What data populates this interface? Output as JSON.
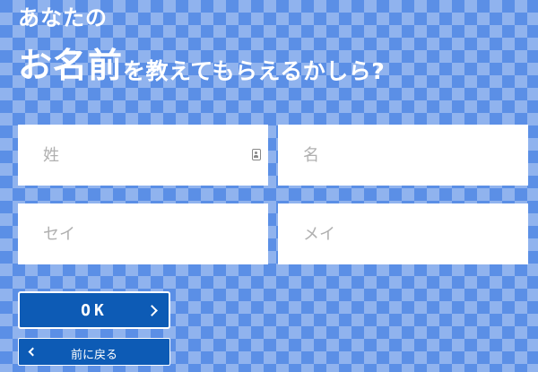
{
  "heading": {
    "line1": "あなたの",
    "emphasis": "お名前",
    "rest": "を教えてもらえるかしら?"
  },
  "form": {
    "last_name_placeholder": "姓",
    "first_name_placeholder": "名",
    "last_name_kana_placeholder": "セイ",
    "first_name_kana_placeholder": "メイ"
  },
  "buttons": {
    "ok_label": "OK",
    "back_label": "前に戻る"
  },
  "icons": {
    "autofill": "contact-card-icon",
    "ok_arrow": "chevron-right-icon",
    "back_arrow": "chevron-left-icon"
  },
  "colors": {
    "background": "#5b8fe6",
    "button": "#0d5bb5",
    "field": "#ffffff",
    "placeholder": "#b0b0b0"
  }
}
